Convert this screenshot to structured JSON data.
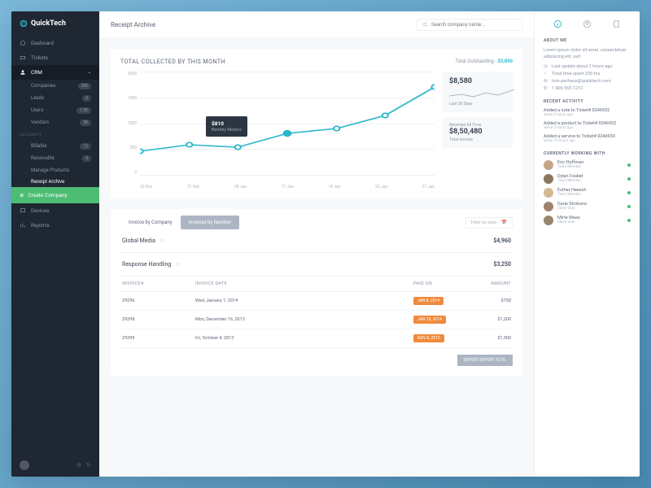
{
  "brand": "QuickTech",
  "sidebar": {
    "main": [
      {
        "label": "Dasboard",
        "icon": "dashboard"
      },
      {
        "label": "Tickets",
        "icon": "ticket"
      }
    ],
    "crm_label": "CRM",
    "crm": [
      {
        "label": "Companies",
        "badge": "300"
      },
      {
        "label": "Leads",
        "badge": "8"
      },
      {
        "label": "Users",
        "badge": "1.3K"
      },
      {
        "label": "Vendors",
        "badge": "58"
      }
    ],
    "accounts_label": "ACCOUNTS",
    "accounts": [
      {
        "label": "Billable",
        "badge": "12"
      },
      {
        "label": "Receivable",
        "badge": "5"
      },
      {
        "label": "Manage Products"
      },
      {
        "label": "Receipt Archive"
      }
    ],
    "create": "Create Company",
    "bottom": [
      {
        "label": "Devices",
        "icon": "devices"
      },
      {
        "label": "Reports",
        "icon": "reports"
      }
    ]
  },
  "page_title": "Receipt Archive",
  "search_placeholder": "Search company name...",
  "chart": {
    "title": "TOTAL COLLECTED BY THIS MONTH",
    "outstanding_label": "Total Outstanding -",
    "outstanding_value": "$5,890",
    "side": {
      "box1_value": "$8,580",
      "box1_sub": "Last 30 Days",
      "box2_label": "Received All Time",
      "box2_value": "$8,50,480",
      "box2_sub": "Total Income"
    },
    "tooltip": {
      "value": "$810",
      "name": "Bentley Motors"
    }
  },
  "chart_data": {
    "type": "line",
    "categories": [
      "30 Dec",
      "31 Dec",
      "08 Jan",
      "11 Jan",
      "18 Jan",
      "22 Jan",
      "27 Jan"
    ],
    "values": [
      450,
      600,
      550,
      810,
      900,
      1150,
      1700
    ],
    "ylabel": "",
    "ylim": [
      0,
      2000
    ],
    "yticks": [
      0,
      500,
      1000,
      1500,
      2000
    ]
  },
  "tabs": {
    "t1": "Invoice by Company",
    "t2": "Invoices by Number",
    "filter": "Filter by date"
  },
  "table": {
    "group1": {
      "name": "Global Media",
      "amount": "$4,960"
    },
    "group2": {
      "name": "Response Handling",
      "amount": "$3,250"
    },
    "columns": {
      "c1": "INVOICE#",
      "c2": "INVOICE DATE",
      "c3": "PAID ON",
      "c4": "AMOUNT"
    },
    "rows": [
      {
        "inv": "29296",
        "date": "Wed, January 1, 2014",
        "paid": "JAN 8, 2014",
        "amt": "$750"
      },
      {
        "inv": "29298",
        "date": "Mon, December 16, 2013",
        "paid": "JAN 18, 2014",
        "amt": "$1,200"
      },
      {
        "inv": "29299",
        "date": "Fri, October 4, 2013",
        "paid": "NOV 8, 2013",
        "amt": "$1,300"
      }
    ],
    "export": "EXPORT REPORT TO XL"
  },
  "right": {
    "about_head": "ABOUT ME",
    "about_text": "Lorem ipsum dolor sit amet, consectetuer adipiscing elit, sed",
    "meta": [
      "Last update about 2 hours ago",
      "Total time spent 230 hrs",
      "tom.pecheux@quicktech.com",
      "1 406 555 1212"
    ],
    "activity_head": "RECENT ACTIVITY",
    "activity": [
      {
        "t": "Added a note to Ticket# 0246932",
        "s": "about 2 hours ago"
      },
      {
        "t": "Added a product to Ticket# 0246932",
        "s": "about 3 hours ago"
      },
      {
        "t": "Added a service to Ticket# 0246930",
        "s": "about 16 hours ago"
      }
    ],
    "working_head": "CURRENTLY WORKING WITH",
    "people": [
      {
        "n": "Eric Hoffman",
        "r": "Team Member"
      },
      {
        "n": "Dylan Fosket",
        "r": "Team Member"
      },
      {
        "n": "Esther Heesch",
        "r": "Team Member"
      },
      {
        "n": "Daria Strokons",
        "r": "Client User"
      },
      {
        "n": "Mirte Maas",
        "r": "Client User"
      }
    ]
  }
}
